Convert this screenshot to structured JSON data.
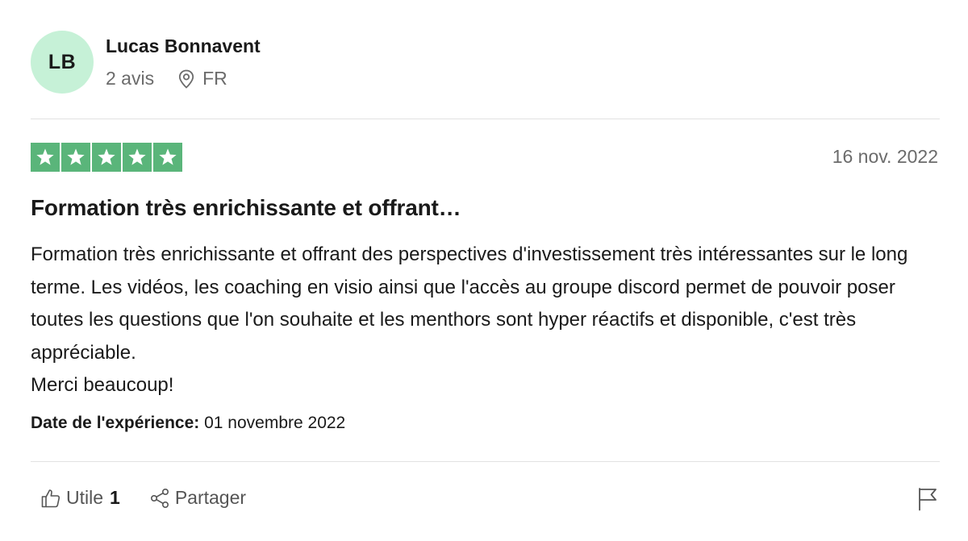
{
  "reviewer": {
    "initials": "LB",
    "name": "Lucas Bonnavent",
    "reviews_count": "2 avis",
    "country": "FR",
    "location_icon": "location-pin-icon"
  },
  "review": {
    "rating": 5,
    "rating_max": 5,
    "date": "16 nov. 2022",
    "title": "Formation très enrichissante et offrant…",
    "body_paragraphs": [
      "Formation très enrichissante et offrant des perspectives d'investissement très intéressantes sur le long terme. Les vidéos, les coaching en visio ainsi que l'accès au groupe discord permet de pouvoir poser toutes les questions que l'on souhaite et les menthors sont hyper réactifs et disponible, c'est très appréciable.",
      "Merci beaucoup!"
    ],
    "experience_label": "Date de l'expérience:",
    "experience_date": "01 novembre 2022"
  },
  "actions": {
    "useful_label": "Utile",
    "useful_count": "1",
    "share_label": "Partager",
    "useful_icon": "thumbs-up-icon",
    "share_icon": "share-icon",
    "report_icon": "flag-icon"
  },
  "colors": {
    "star_green": "#5ab57a",
    "avatar_bg": "#c6f1d7",
    "muted_text": "#6b6b6b"
  }
}
